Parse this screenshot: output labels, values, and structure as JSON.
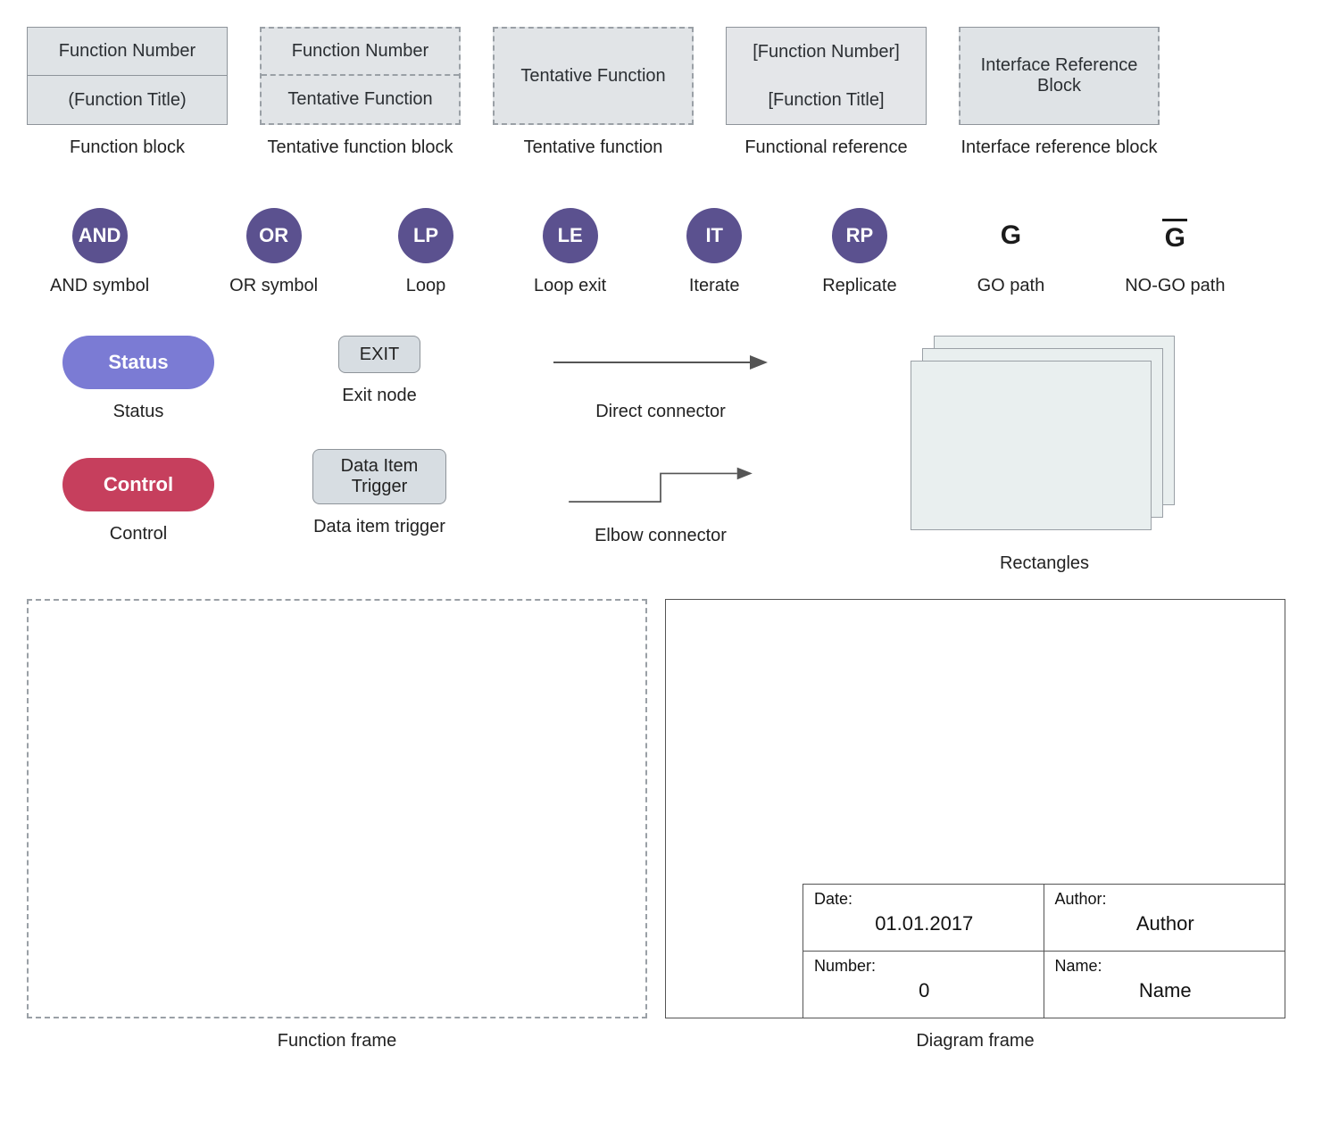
{
  "row1": {
    "block1_top": "Function Number",
    "block1_bot": "(Function Title)",
    "block1_cap": "Function block",
    "block2_top": "Function Number",
    "block2_bot": "Tentative Function",
    "block2_cap": "Tentative function block",
    "block3": "Tentative Function",
    "block3_cap": "Tentative function",
    "block4_top": "[Function Number]",
    "block4_bot": "[Function Title]",
    "block4_cap": "Functional reference",
    "block5": "Interface Reference Block",
    "block5_cap": "Interface reference block"
  },
  "row2": {
    "and": "AND",
    "and_cap": "AND symbol",
    "or": "OR",
    "or_cap": "OR symbol",
    "lp": "LP",
    "lp_cap": "Loop",
    "le": "LE",
    "le_cap": "Loop exit",
    "it": "IT",
    "it_cap": "Iterate",
    "rp": "RP",
    "rp_cap": "Replicate",
    "go": "G",
    "go_cap": "GO path",
    "nogo": "G",
    "nogo_cap": "NO-GO path"
  },
  "row3": {
    "status": "Status",
    "status_cap": "Status",
    "control": "Control",
    "control_cap": "Control",
    "exit": "EXIT",
    "exit_cap": "Exit node",
    "dit": "Data Item Trigger",
    "dit_cap": "Data item trigger",
    "direct_cap": "Direct connector",
    "elbow_cap": "Elbow connector",
    "rects_cap": "Rectangles"
  },
  "row4": {
    "ff_cap": "Function frame",
    "df_cap": "Diagram frame",
    "date_label": "Date:",
    "date_val": "01.01.2017",
    "author_label": "Author:",
    "author_val": "Author",
    "number_label": "Number:",
    "number_val": "0",
    "name_label": "Name:",
    "name_val": "Name"
  }
}
